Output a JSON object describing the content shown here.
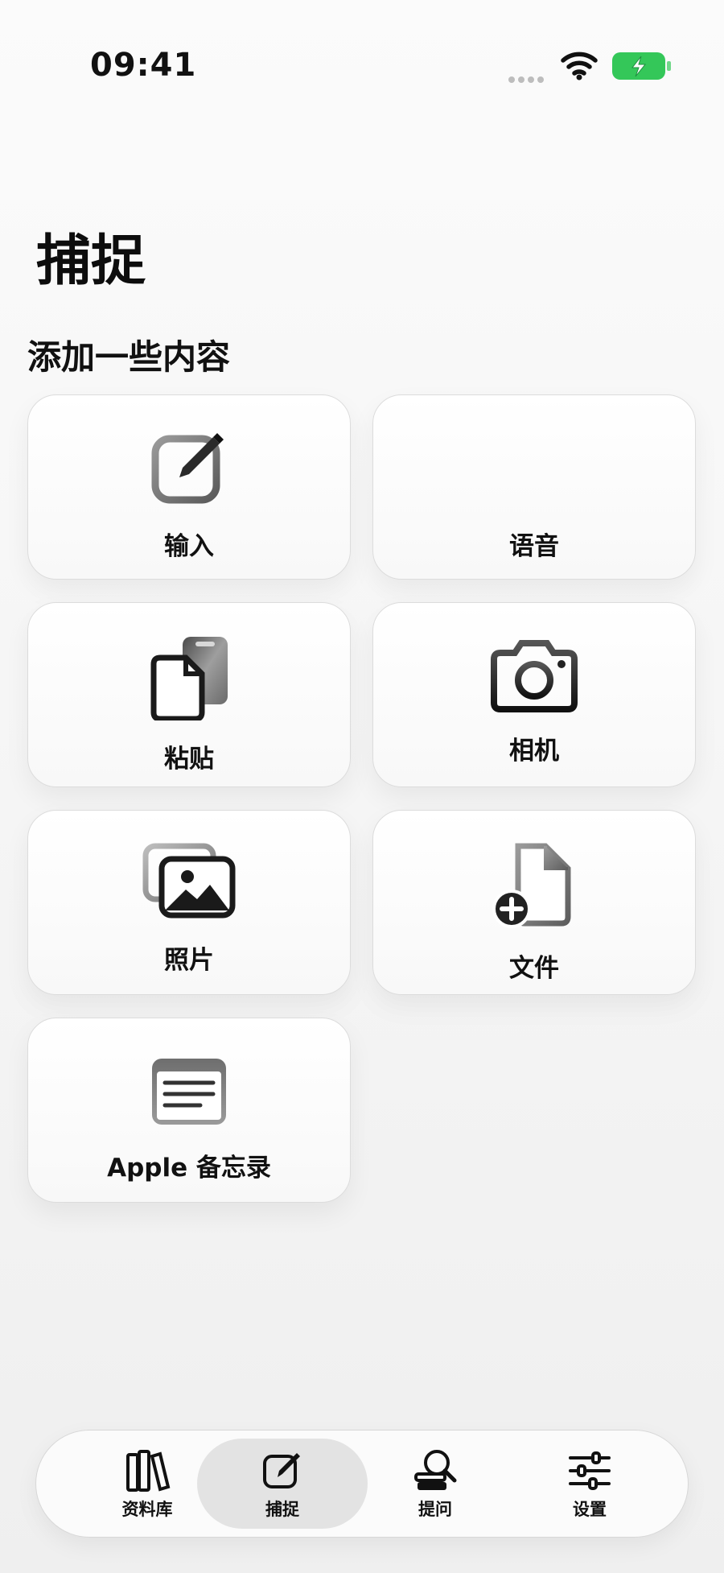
{
  "status_bar": {
    "time": "09:41"
  },
  "header": {
    "title": "捕捉",
    "subtitle": "添加一些内容"
  },
  "cards": [
    {
      "label": "输入",
      "icon": "compose-icon"
    },
    {
      "label": "语音",
      "icon": "waveform-icon"
    },
    {
      "label": "粘贴",
      "icon": "paste-icon"
    },
    {
      "label": "相机",
      "icon": "camera-icon"
    },
    {
      "label": "照片",
      "icon": "photos-icon"
    },
    {
      "label": "文件",
      "icon": "file-add-icon"
    },
    {
      "label": "Apple 备忘录",
      "icon": "notes-icon"
    }
  ],
  "tab_bar": {
    "tabs": [
      {
        "label": "资料库",
        "icon": "books-icon"
      },
      {
        "label": "捕捉",
        "icon": "compose-icon",
        "active": true
      },
      {
        "label": "提问",
        "icon": "ask-icon"
      },
      {
        "label": "设置",
        "icon": "sliders-icon"
      }
    ]
  },
  "colors": {
    "battery": "#34c759",
    "active_tab": "#e3e3e3",
    "text": "#111111"
  }
}
